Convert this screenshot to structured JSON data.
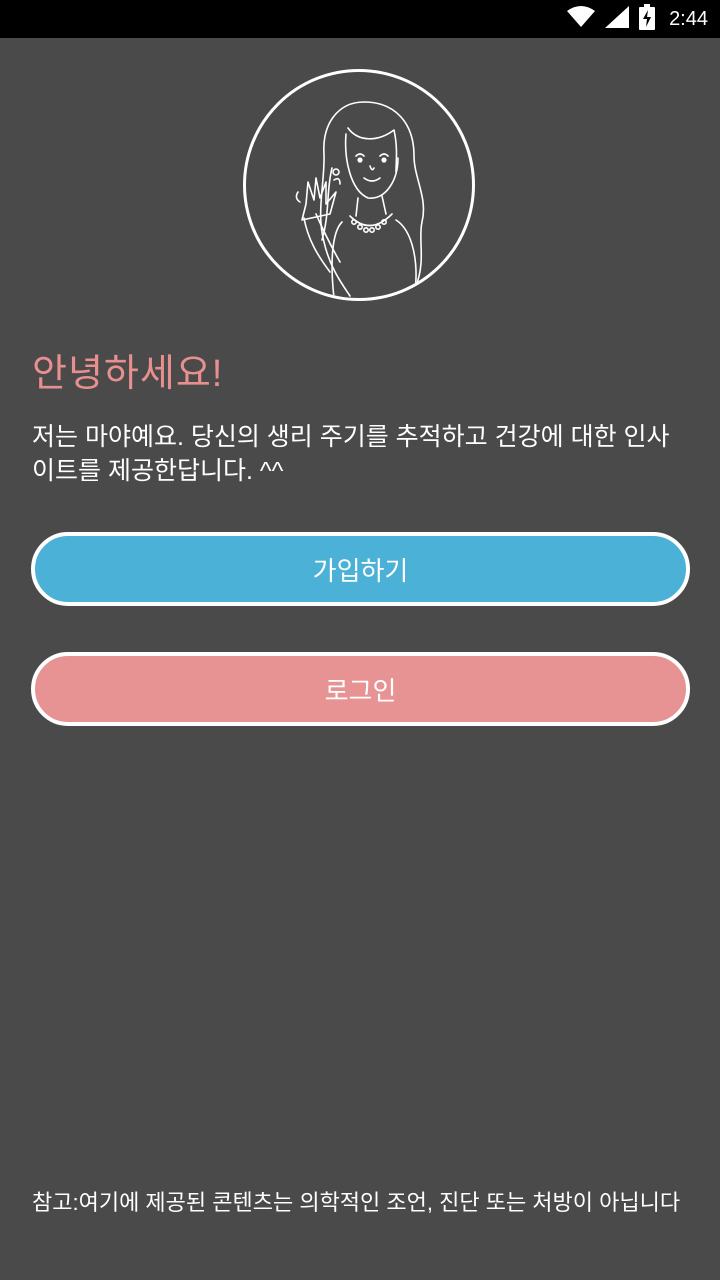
{
  "status_bar": {
    "time": "2:44",
    "icons": [
      "wifi-icon",
      "signal-icon",
      "battery-charging-icon"
    ]
  },
  "avatar": {
    "icon": "waving-woman-illustration"
  },
  "welcome": {
    "greeting": "안녕하세요!",
    "intro": "저는 마야예요. 당신의 생리 주기를 추적하고 건강에 대한 인사이트를 제공한답니다. ^^"
  },
  "buttons": {
    "signup_label": "가입하기",
    "login_label": "로그인"
  },
  "disclaimer": "참고:여기에 제공된 콘텐츠는 의학적인 조언, 진단 또는 처방이 아닙니다",
  "colors": {
    "background": "#4a4a4a",
    "greeting": "#e88f8f",
    "signup": "#4bb1d6",
    "login": "#e79393"
  }
}
